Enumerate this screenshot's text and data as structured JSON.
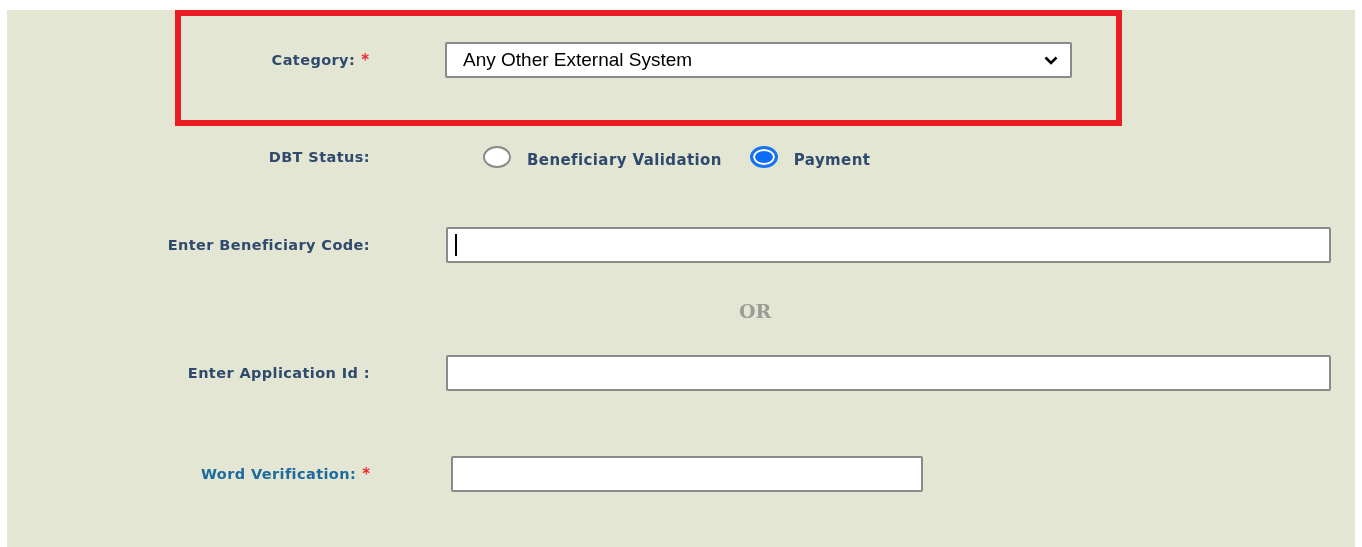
{
  "category": {
    "label": "Category:",
    "required_mark": "*",
    "value": "Any Other External System",
    "highlighted": true
  },
  "dbt_status": {
    "label": "DBT Status:",
    "options": [
      {
        "label": "Beneficiary Validation",
        "selected": false
      },
      {
        "label": "Payment",
        "selected": true
      }
    ]
  },
  "beneficiary_code": {
    "label": "Enter Beneficiary Code:",
    "focused": true
  },
  "separator": "OR",
  "application_id": {
    "label": "Enter Application Id :",
    "focused": false
  },
  "word_verification": {
    "label": "Word Verification:",
    "required_mark": "*",
    "focused": false
  }
}
